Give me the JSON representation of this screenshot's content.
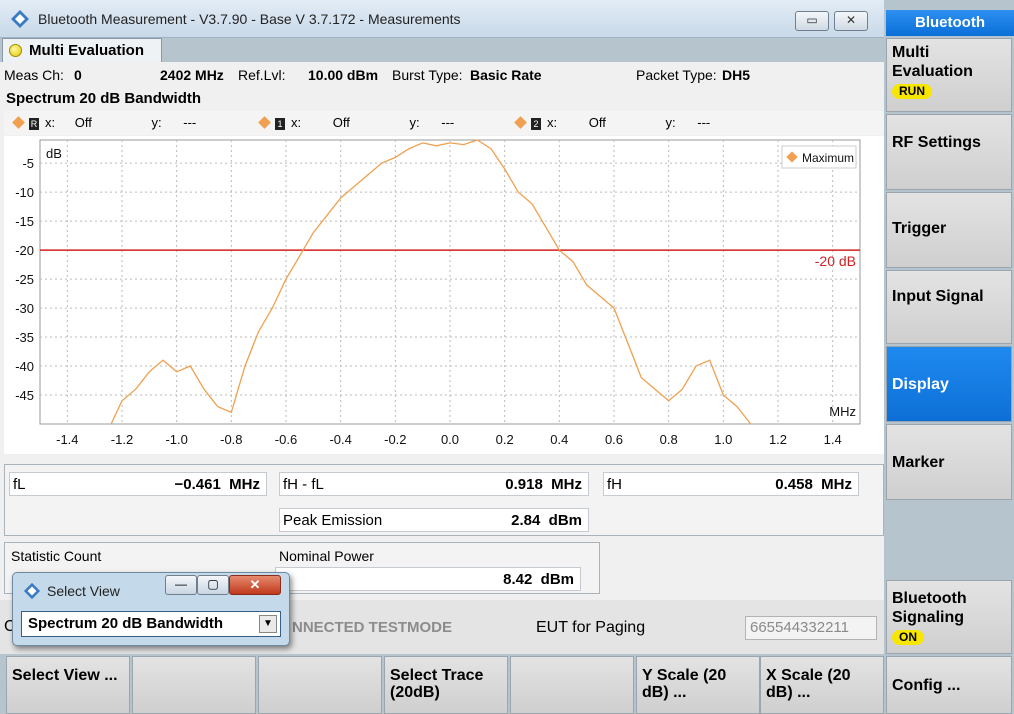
{
  "window": {
    "title": "Bluetooth Measurement  - V3.7.90 - Base V 3.7.172 - Measurements",
    "minimize": "▭",
    "close": "✕"
  },
  "tab": {
    "label": "Multi Evaluation"
  },
  "info": {
    "meas_ch_label": "Meas Ch:",
    "meas_ch": "0",
    "freq": "2402 MHz",
    "ref_lvl_label": "Ref.Lvl:",
    "ref_lvl": "10.00 dBm",
    "burst_type_label": "Burst Type:",
    "burst_type": "Basic Rate",
    "packet_type_label": "Packet Type:",
    "packet_type": "DH5"
  },
  "chart_title": "Spectrum 20 dB Bandwidth",
  "markers": [
    {
      "id": "R",
      "x_label": "x:",
      "x": "Off",
      "y_label": "y:",
      "y": "---"
    },
    {
      "id": "1",
      "x_label": "x:",
      "x": "Off",
      "y_label": "y:",
      "y": "---"
    },
    {
      "id": "2",
      "x_label": "x:",
      "x": "Off",
      "y_label": "y:",
      "y": "---"
    }
  ],
  "chart_data": {
    "type": "line",
    "ylabel": "dB",
    "xlabel": "MHz",
    "xlim": [
      -1.5,
      1.5
    ],
    "ylim": [
      -50,
      -1
    ],
    "xticks": [
      -1.4,
      -1.2,
      -1.0,
      -0.8,
      -0.6,
      -0.4,
      -0.2,
      0.0,
      0.2,
      0.4,
      0.6,
      0.8,
      1.0,
      1.2,
      1.4
    ],
    "yticks": [
      -5,
      -10,
      -15,
      -20,
      -25,
      -30,
      -35,
      -40,
      -45
    ],
    "grid": true,
    "legend": "top-right",
    "threshold": {
      "value": -20,
      "label": "-20 dB",
      "color": "#d42020"
    },
    "series": [
      {
        "name": "Maximum",
        "color": "#f0a050",
        "x": [
          -1.24,
          -1.2,
          -1.15,
          -1.1,
          -1.05,
          -1.0,
          -0.95,
          -0.9,
          -0.85,
          -0.8,
          -0.75,
          -0.7,
          -0.65,
          -0.6,
          -0.55,
          -0.5,
          -0.45,
          -0.4,
          -0.35,
          -0.3,
          -0.25,
          -0.2,
          -0.15,
          -0.1,
          -0.05,
          0.0,
          0.05,
          0.1,
          0.15,
          0.2,
          0.25,
          0.3,
          0.35,
          0.4,
          0.45,
          0.5,
          0.55,
          0.6,
          0.65,
          0.7,
          0.75,
          0.8,
          0.85,
          0.9,
          0.95,
          1.0,
          1.05,
          1.1
        ],
        "y": [
          -50,
          -46,
          -44,
          -41,
          -39,
          -41,
          -40,
          -44,
          -47,
          -48,
          -40,
          -34,
          -30,
          -25,
          -21,
          -17,
          -14,
          -11,
          -9,
          -7,
          -5,
          -4,
          -2.5,
          -1.5,
          -2,
          -1.5,
          -1.8,
          -1,
          -2.5,
          -6,
          -10,
          -12,
          -16,
          -20,
          -22,
          -26,
          -28,
          -30,
          -36,
          -42,
          -44,
          -46,
          -44,
          -40,
          -39,
          -45,
          -47,
          -50
        ]
      }
    ]
  },
  "results": {
    "fl_label": "fL",
    "fl_value": "−0.461",
    "fl_unit": "MHz",
    "fhfl_label": "fH - fL",
    "fhfl_value": "0.918",
    "fhfl_unit": "MHz",
    "fh_label": "fH",
    "fh_value": "0.458",
    "fh_unit": "MHz",
    "peak_label": "Peak Emission",
    "peak_value": "2.84",
    "peak_unit": "dBm",
    "stat_label": "Statistic Count",
    "nominal_label": "Nominal Power",
    "nominal_value": "8.42",
    "nominal_unit": "dBm"
  },
  "signaling": {
    "mode": "NNECTED TESTMODE",
    "eut": "EUT for Paging",
    "address": "665544332211"
  },
  "popup": {
    "title": "Select View",
    "selected": "Spectrum 20 dB Bandwidth"
  },
  "right_panel": {
    "header": "Bluetooth",
    "buttons": [
      {
        "label": "Multi Evaluation",
        "badge": "RUN"
      },
      {
        "label": "RF Settings"
      },
      {
        "label": "Trigger"
      },
      {
        "label": "Input Signal"
      },
      {
        "label": "Display"
      },
      {
        "label": "Marker"
      },
      {
        "label": "Bluetooth Signaling",
        "badge": "ON"
      }
    ]
  },
  "bottom_bar": [
    {
      "label": "Select View ..."
    },
    {
      "label": ""
    },
    {
      "label": ""
    },
    {
      "label": "Select Trace (20dB)"
    },
    {
      "label": ""
    },
    {
      "label": "Y Scale (20 dB) ..."
    },
    {
      "label": "X Scale (20 dB) ..."
    },
    {
      "label": "Config ..."
    }
  ]
}
